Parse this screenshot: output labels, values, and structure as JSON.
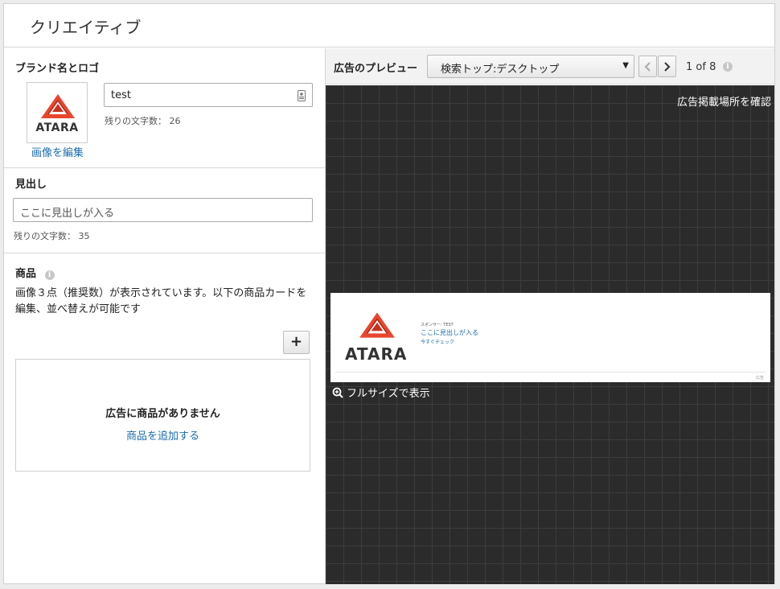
{
  "header": {
    "title": "クリエイティブ"
  },
  "brand": {
    "section_title": "ブランド名とロゴ",
    "logo_text": "ATARA",
    "edit_image_label": "画像を編集",
    "name_value": "test",
    "remaining_label": "残りの文字数： 26"
  },
  "headline": {
    "section_title": "見出し",
    "placeholder": "ここに見出しが入る",
    "remaining_label": "残りの文字数： 35"
  },
  "products": {
    "section_title": "商品",
    "description": "画像３点（推奨数）が表示されています。以下の商品カードを編集、並べ替えが可能です",
    "add_button": "+",
    "empty_title": "広告に商品がありません",
    "add_product_link": "商品を追加する"
  },
  "preview": {
    "label": "広告のプレビュー",
    "placement_selected": "検索トップ:デスクトップ",
    "pager_text": "1 of 8",
    "confirm_placement": "広告掲載場所を確認",
    "ad_sponsor": "スポンサー: TEST",
    "ad_headline": "ここに見出しが入る",
    "ad_cta": "今すぐチェック",
    "ad_logo_text": "ATARA",
    "ad_tag": "広告",
    "fullsize_label": "フルサイズで表示"
  },
  "colors": {
    "accent": "#1a6cb0",
    "logo_red": "#e8462e",
    "canvas_bg": "#2b2b2b"
  }
}
